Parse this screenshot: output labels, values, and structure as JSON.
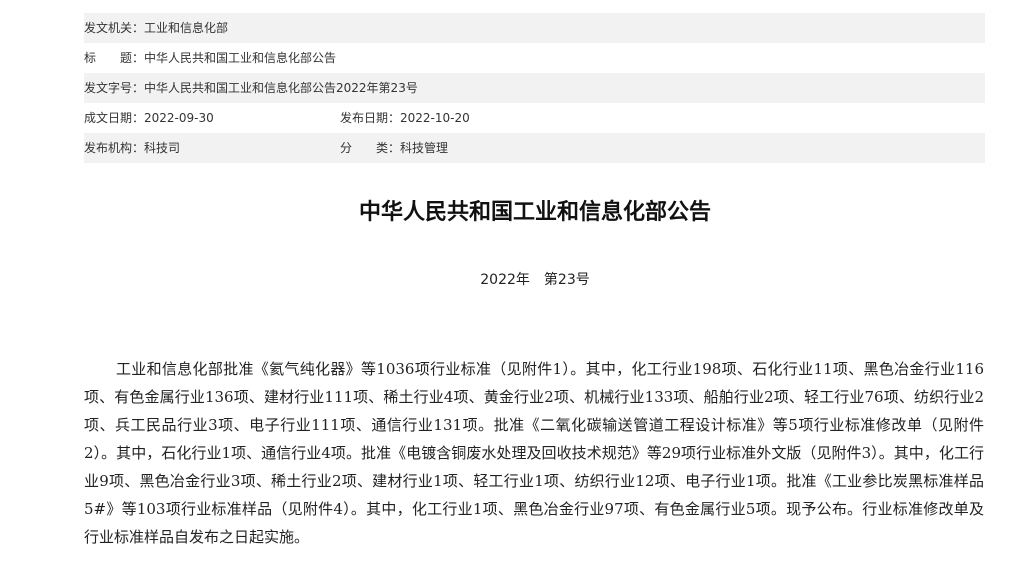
{
  "metadata": {
    "issuer": {
      "label": "发文机关：",
      "value": "工业和信息化部"
    },
    "title": {
      "label": "标　　题：",
      "value": "中华人民共和国工业和信息化部公告"
    },
    "doc_no": {
      "label": "发文字号：",
      "value": "中华人民共和国工业和信息化部公告2022年第23号"
    },
    "created_date": {
      "label": "成文日期：",
      "value": "2022-09-30"
    },
    "publish_date": {
      "label": "发布日期：",
      "value": "2022-10-20"
    },
    "publisher": {
      "label": "发布机构：",
      "value": "科技司"
    },
    "category": {
      "label": "分　　类：",
      "value": "科技管理"
    }
  },
  "document": {
    "title": "中华人民共和国工业和信息化部公告",
    "year": "2022年",
    "number": "第23号",
    "paragraph": "工业和信息化部批准《氦气纯化器》等1036项行业标准（见附件1）。其中，化工行业198项、石化行业11项、黑色冶金行业116项、有色金属行业136项、建材行业111项、稀土行业4项、黄金行业2项、机械行业133项、船舶行业2项、轻工行业76项、纺织行业2项、兵工民品行业3项、电子行业111项、通信行业131项。批准《二氧化碳输送管道工程设计标准》等5项行业标准修改单（见附件2）。其中，石化行业1项、通信行业4项。批准《电镀含铜废水处理及回收技术规范》等29项行业标准外文版（见附件3）。其中，化工行业9项、黑色冶金行业3项、稀土行业2项、建材行业1项、轻工行业1项、纺织行业12项、电子行业1项。批准《工业参比炭黑标准样品 5#》等103项行业标准样品（见附件4）。其中，化工行业1项、黑色冶金行业97项、有色金属行业5项。现予公布。行业标准修改单及行业标准样品自发布之日起实施。"
  }
}
